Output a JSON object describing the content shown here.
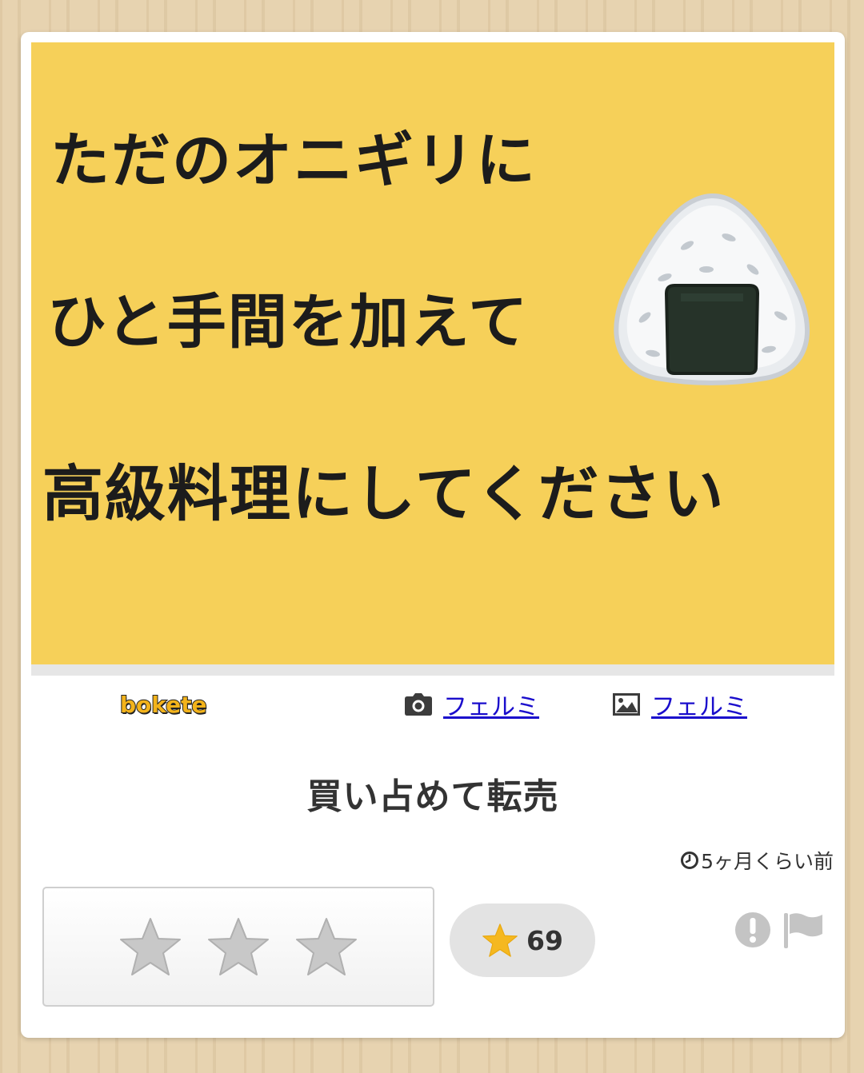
{
  "post_image": {
    "lines": [
      "ただのオニギリに",
      "ひと手間を加えて",
      "高級料理にしてください"
    ],
    "illustration": "onigiri-icon",
    "background_color": "#f6d059"
  },
  "meta": {
    "logo_text": "bokete",
    "photo_credit": "フェルミ",
    "image_credit": "フェルミ"
  },
  "caption": "買い占めて転売",
  "timestamp": "5ヶ月くらい前",
  "rating": {
    "stars": [
      "star-1",
      "star-2",
      "star-3"
    ],
    "score": "69"
  },
  "actions": {
    "report_icon": "exclamation-icon",
    "flag_icon": "flag-icon"
  },
  "colors": {
    "link": "#1a0dcc",
    "star_gold": "#f5b820",
    "star_gray": "#c8c8c8"
  }
}
